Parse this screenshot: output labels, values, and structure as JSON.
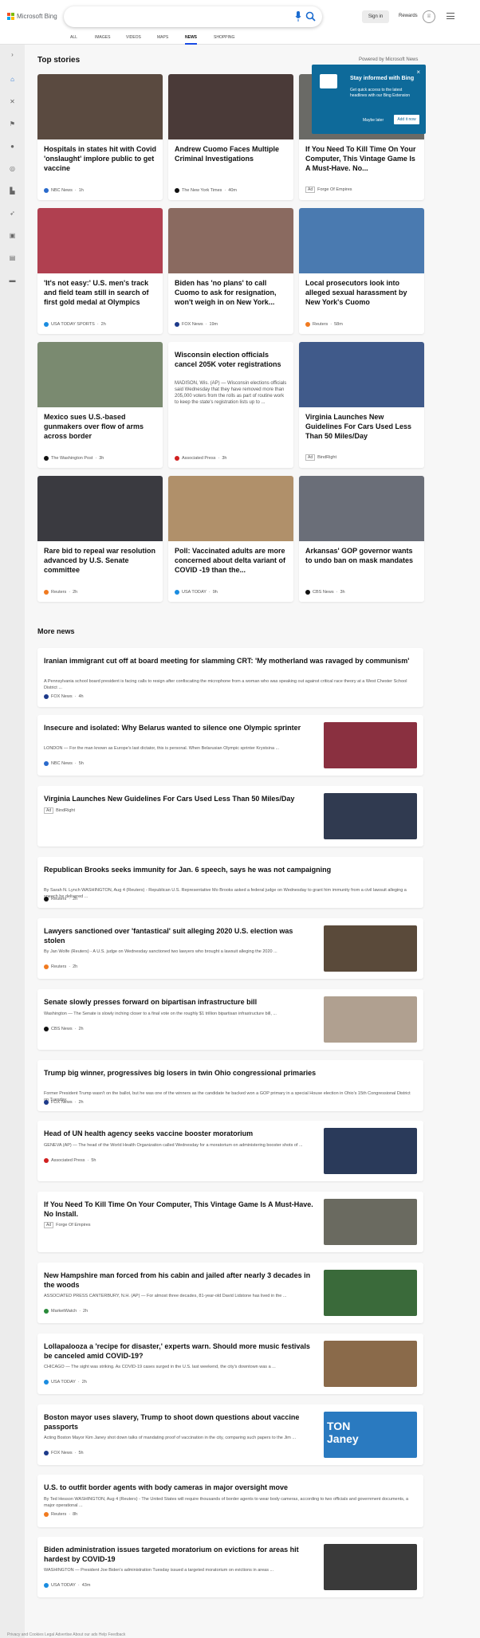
{
  "app": {
    "title": "Microsoft Bing"
  },
  "header": {
    "signin": "Sign in",
    "rewards": "Rewards"
  },
  "nav": [
    {
      "label": "ALL",
      "active": false
    },
    {
      "label": "IMAGES",
      "active": false
    },
    {
      "label": "VIDEOS",
      "active": false
    },
    {
      "label": "MAPS",
      "active": false
    },
    {
      "label": "NEWS",
      "active": true
    },
    {
      "label": "SHOPPING",
      "active": false
    }
  ],
  "top_stories": {
    "heading": "Top stories",
    "powered": "Powered by Microsoft News"
  },
  "popup": {
    "title": "Stay informed with Bing",
    "body": "Get quick access to the latest headlines with our Bing Extension",
    "later": "Maybe later",
    "add": "Add it now"
  },
  "cards": [
    {
      "title": "Hospitals in states hit with Covid 'onslaught' implore public to get vaccine",
      "source": "NBC News",
      "time": "1h",
      "img": "#5a4a40",
      "ic": "#2a6acc"
    },
    {
      "title": "Andrew Cuomo Faces Multiple Criminal Investigations",
      "source": "The New York Times",
      "time": "40m",
      "img": "#4a3a38",
      "ic": "#111111"
    },
    {
      "title": "If You Need To Kill Time On Your Computer, This Vintage Game Is A Must-Have. No...",
      "source": "Forge Of Empires",
      "ad": "Ad",
      "img": "#6a6a66",
      "ic": "#888888"
    },
    {
      "title": "'It's not easy:' U.S. men's track and field team still in search of first gold medal at Olympics",
      "source": "USA TODAY SPORTS",
      "time": "2h",
      "img": "#b04050",
      "ic": "#1a8ce0"
    },
    {
      "title": "Biden has 'no plans' to call Cuomo to ask for resignation, won't weigh in on New York...",
      "source": "FOX News",
      "time": "19m",
      "img": "#8a6a60",
      "ic": "#1d3a8a"
    },
    {
      "title": "Local prosecutors look into alleged sexual harassment by New York's Cuomo",
      "source": "Reuters",
      "time": "58m",
      "img": "#4a7ab0",
      "ic": "#f07a20"
    },
    {
      "title": "Mexico sues U.S.-based gunmakers over flow of arms across border",
      "source": "The Washington Post",
      "time": "3h",
      "img": "#7a8a70",
      "ic": "#111111"
    },
    {
      "title": "Wisconsin election officials cancel 205K voter registrations",
      "snippet": "MADISON, Wis. (AP) — Wisconsin elections officials said Wednesday that they have removed more than 205,000 voters from the rolls as part of routine work to keep the state's registration lists up to ...",
      "source": "Associated Press",
      "time": "3h",
      "ic": "#d02020"
    },
    {
      "title": "Virginia Launches New Guidelines For Cars Used Less Than 50 Miles/Day",
      "source": "BindRight",
      "ad": "Ad",
      "img": "#405a8a",
      "ic": "#888888"
    },
    {
      "title": "Rare bid to repeal war resolution advanced by U.S. Senate committee",
      "source": "Reuters",
      "time": "2h",
      "img": "#3a3a40",
      "ic": "#f07a20"
    },
    {
      "title": "Poll: Vaccinated adults are more concerned about delta variant of COVID -19 than the...",
      "source": "USA TODAY",
      "time": "9h",
      "img": "#b0906a",
      "ic": "#1a8ce0"
    },
    {
      "title": "Arkansas' GOP governor wants to undo ban on mask mandates",
      "source": "CBS News",
      "time": "3h",
      "img": "#6a6e78",
      "ic": "#111111"
    }
  ],
  "more_news": {
    "heading": "More news",
    "items": [
      {
        "title": "Iranian immigrant cut off at board meeting for slamming CRT: 'My motherland was ravaged by communism'",
        "snippet": "A Pennsylvania school board president is facing calls to resign after confiscating the microphone from a woman who was speaking out against critical race theory at a West Chester School District ...",
        "source": "FOX News",
        "time": "4h",
        "ic": "#1d3a8a"
      },
      {
        "title": "Insecure and isolated: Why Belarus wanted to silence one Olympic sprinter",
        "snippet": "LONDON — For the man known as Europe's last dictator, this is personal. When Belarusian Olympic sprinter Krystsina ...",
        "source": "NBC News",
        "time": "5h",
        "ic": "#2a6acc",
        "thumb": "#8a3040"
      },
      {
        "title": "Virginia Launches New Guidelines For Cars Used Less Than 50 Miles/Day",
        "source": "BindRight",
        "ad": "Ad",
        "ic": "#888888",
        "thumb": "#303a50"
      },
      {
        "title": "Republican Brooks seeks immunity for Jan. 6 speech, says he was not campaigning",
        "snippet": "By Sarah N. Lynch WASHINGTON, Aug 4 (Reuters) - Republican U.S. Representative Mo Brooks asked a federal judge on Wednesday to grant him immunity from a civil lawsuit alleging a speech he delivered ...",
        "source": "Reuters",
        "time": "2h",
        "ic": "#111111"
      },
      {
        "title": "Lawyers sanctioned over 'fantastical' suit alleging 2020 U.S. election was stolen",
        "snippet": "By Jan Wolfe (Reuters) - A U.S. judge on Wednesday sanctioned two lawyers who brought a lawsuit alleging the 2020 ...",
        "source": "Reuters",
        "time": "2h",
        "ic": "#f07a20",
        "thumb": "#5a4a3a"
      },
      {
        "title": "Senate slowly presses forward on bipartisan infrastructure bill",
        "snippet": "Washington — The Senate is slowly inching closer to a final vote on the roughly $1 trillion bipartisan infrastructure bill, ...",
        "source": "CBS News",
        "time": "2h",
        "ic": "#111111",
        "thumb": "#b0a090"
      },
      {
        "title": "Trump big winner, progressives big losers in twin Ohio congressional primaries",
        "snippet": "Former President Trump wasn't on the ballot, but he was one of the winners as the candidate he backed won a GOP primary in a special House election in Ohio's 15th Congressional District on Tuesday.",
        "source": "FOX News",
        "time": "2h",
        "ic": "#1d3a8a"
      },
      {
        "title": "Head of UN health agency seeks vaccine booster moratorium",
        "snippet": "GENEVA (AP) — The head of the World Health Organization called Wednesday for a moratorium on administering booster shots of ...",
        "source": "Associated Press",
        "time": "5h",
        "ic": "#d02020",
        "thumb": "#2a3a5a"
      },
      {
        "title": "If You Need To Kill Time On Your Computer, This Vintage Game Is A Must-Have. No Install.",
        "source": "Forge Of Empires",
        "ad": "Ad",
        "ic": "#888888",
        "thumb": "#6a6a60"
      },
      {
        "title": "New Hampshire man forced from his cabin and jailed after nearly 3 decades in the woods",
        "snippet": "ASSOCIATED PRESS CANTERBURY, N.H. (AP) — For almost three decades, 81-year-old David Lidstone has lived in the ...",
        "source": "MarketWatch",
        "time": "2h",
        "ic": "#2a8a3a",
        "thumb": "#3a6a3a"
      },
      {
        "title": "Lollapalooza a 'recipe for disaster,' experts warn. Should more music festivals be canceled amid COVID-19?",
        "snippet": "CHICAGO — The sight was striking. As COVID-19 cases surged in the U.S. last weekend, the city's downtown was a ...",
        "source": "USA TODAY",
        "time": "2h",
        "ic": "#1a8ce0",
        "thumb": "#8a6a4a"
      },
      {
        "title": "Boston mayor uses slavery, Trump to shoot down questions about vaccine passports",
        "snippet": "Acting Boston Mayor Kim Janey shot down talks of mandating proof of vaccination in the city, comparing such papers to the Jim ...",
        "source": "FOX News",
        "time": "5h",
        "ic": "#1d3a8a",
        "thumb": "#2a7ac0",
        "thumb_text": "TON\nJaney"
      },
      {
        "title": "U.S. to outfit border agents with body cameras in major oversight move",
        "snippet": "By Ted Hesson WASHINGTON, Aug 4 (Reuters) - The United States will require thousands of border agents to wear body cameras, according to two officials and government documents, a major operational ...",
        "source": "Reuters",
        "time": "8h",
        "ic": "#f07a20"
      },
      {
        "title": "Biden administration issues targeted moratorium on evictions for areas hit hardest by COVID-19",
        "snippet": "WASHINGTON — President Joe Biden's administration Tuesday issued a targeted moratorium on evictions in areas ...",
        "source": "USA TODAY",
        "time": "43m",
        "ic": "#1a8ce0",
        "thumb": "#3a3a3a"
      }
    ]
  },
  "footer": {
    "text": "Privacy and Cookies  Legal  Advertise  About our ads  Help  Feedback"
  }
}
